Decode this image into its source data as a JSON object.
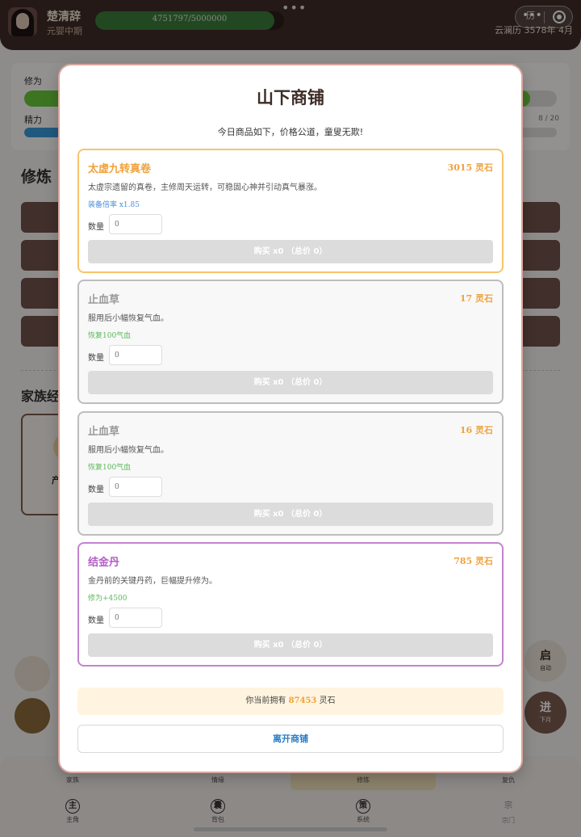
{
  "header": {
    "player_name": "楚清辞",
    "realm": "元婴中期",
    "exp_text": "4751797/5000000",
    "exp_fraction": 0.95,
    "calendar": "云澜历 3578年 4月",
    "calendar_tab": "历"
  },
  "stats": {
    "cultivation_label": "修为",
    "energy_label": "精力",
    "energy_count": "8 / 20"
  },
  "sections": {
    "cultivate_title": "修炼",
    "family_title": "家族经",
    "family_card_char": "产"
  },
  "side_buttons": {
    "start_big": "启",
    "start_small": "自动",
    "next_big": "进",
    "next_small": "下月"
  },
  "bottom_nav": {
    "row1": [
      "家族",
      "情缘",
      "修炼",
      "复仇"
    ],
    "row2": [
      {
        "icon": "主",
        "label": "主角"
      },
      {
        "icon": "囊",
        "label": "背包"
      },
      {
        "icon": "策",
        "label": "系统"
      },
      {
        "icon": "宗",
        "label": "宗门"
      }
    ]
  },
  "shop": {
    "title": "山下商铺",
    "subtitle": "今日商品如下，价格公道，童叟无欺!",
    "qty_label": "数量",
    "qty_placeholder": "0",
    "items": [
      {
        "name": "太虚九转真卷",
        "price": "3015 灵石",
        "desc": "太虚宗遗留的真卷，主修周天运转，可稳固心神并引动真气暴涨。",
        "effect": "装备倍率 x1.85",
        "buy_label": "购买 x0 （总价 0）",
        "rarity_color": "#f6c56a",
        "name_color": "#f0a23c",
        "effect_color": "#4a90d9"
      },
      {
        "name": "止血草",
        "price": "17 灵石",
        "desc": "服用后小幅恢复气血。",
        "effect": "恢复100气血",
        "buy_label": "购买 x0 （总价 0）",
        "rarity_color": "#bdbdbd",
        "name_color": "#9a9a9a",
        "effect_color": "#5cb85c"
      },
      {
        "name": "止血草",
        "price": "16 灵石",
        "desc": "服用后小幅恢复气血。",
        "effect": "恢复100气血",
        "buy_label": "购买 x0 （总价 0）",
        "rarity_color": "#bdbdbd",
        "name_color": "#9a9a9a",
        "effect_color": "#5cb85c"
      },
      {
        "name": "结金丹",
        "price": "785 灵石",
        "desc": "金丹前的关键丹药，巨幅提升修为。",
        "effect": "修为+4500",
        "buy_label": "购买 x0 （总价 0）",
        "rarity_color": "#c383d0",
        "name_color": "#b25ec4",
        "effect_color": "#5cb85c"
      }
    ],
    "balance_prefix": "你当前拥有",
    "balance_amount": "87453",
    "balance_suffix": "灵石",
    "leave_label": "离开商铺"
  }
}
